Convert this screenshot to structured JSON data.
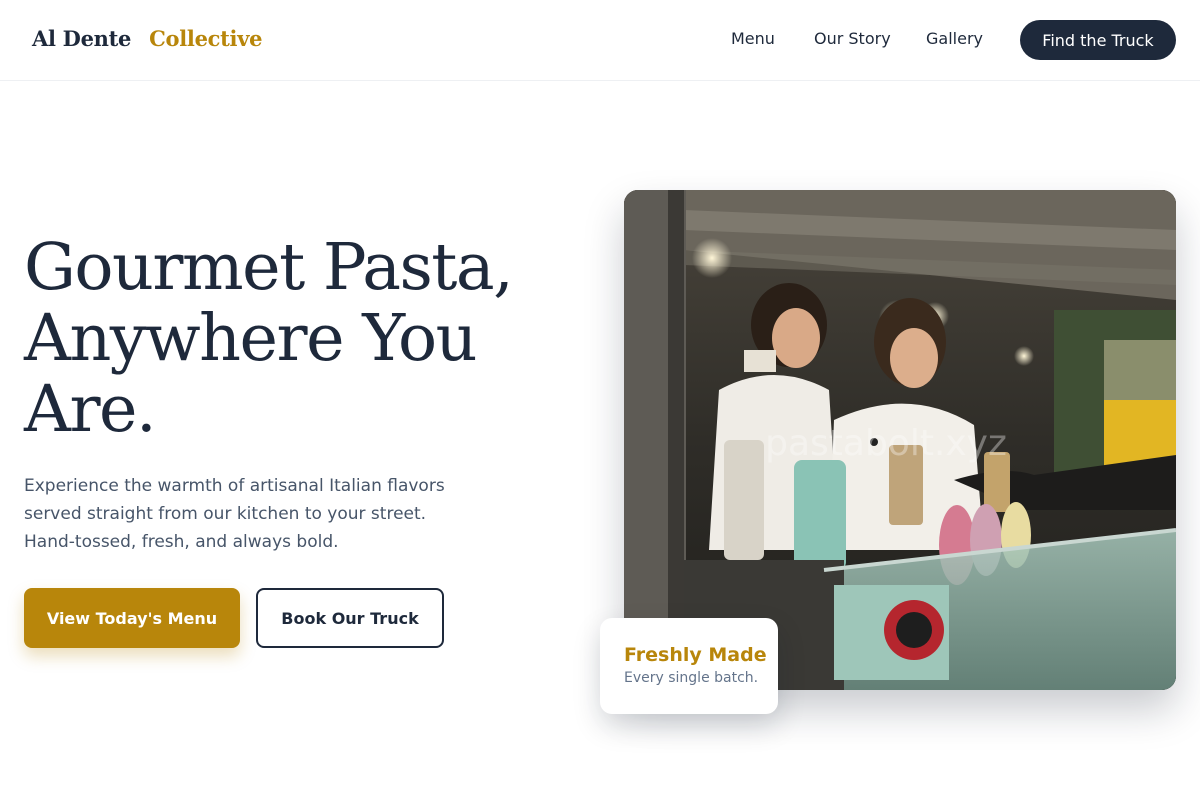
{
  "brand": {
    "part1": "Al Dente",
    "part2": "Collective"
  },
  "nav": {
    "links": [
      "Menu",
      "Our Story",
      "Gallery"
    ],
    "cta": "Find the Truck"
  },
  "hero": {
    "title_lines": [
      "Gourmet Pasta,",
      "Anywhere You",
      "Are."
    ],
    "subtitle_lines": [
      "Experience the warmth of artisanal Italian flavors",
      "served straight from our kitchen to your street.",
      "Hand-tossed, fresh, and always bold."
    ],
    "primary_button": "View Today's Menu",
    "secondary_button": "Book Our Truck"
  },
  "photo": {
    "watermark": "pastabolt.xyz"
  },
  "badge": {
    "title": "Freshly Made",
    "subtitle": "Every single batch."
  },
  "colors": {
    "navy": "#1e293b",
    "gold": "#b8860b",
    "muted": "#64748b"
  }
}
